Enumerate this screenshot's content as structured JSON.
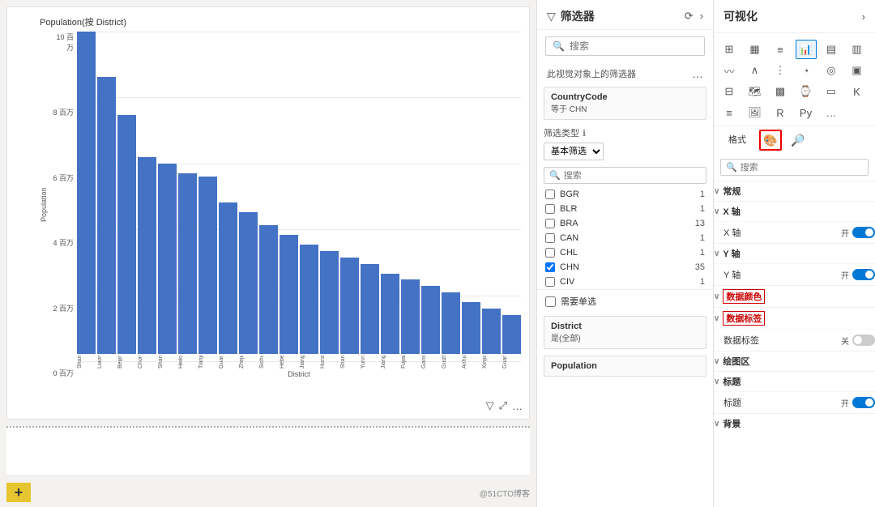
{
  "chart": {
    "title": "Population(按 District)",
    "y_axis_label": "Population",
    "x_axis_title": "District",
    "y_labels": [
      "10 百万",
      "8 百万",
      "6 百万",
      "4 百万",
      "2 百万",
      "0 百万"
    ],
    "bars": [
      {
        "label": "Shanghai",
        "value": 100
      },
      {
        "label": "Liaoning",
        "value": 86
      },
      {
        "label": "Beijing",
        "value": 74
      },
      {
        "label": "Chongqing",
        "value": 61
      },
      {
        "label": "Shandong",
        "value": 59
      },
      {
        "label": "Heilongjiang",
        "value": 56
      },
      {
        "label": "Tianjin",
        "value": 55
      },
      {
        "label": "Guangdong",
        "value": 47
      },
      {
        "label": "Zhejiang",
        "value": 44
      },
      {
        "label": "Sichuan",
        "value": 40
      },
      {
        "label": "Hebei",
        "value": 37
      },
      {
        "label": "Jiangsu",
        "value": 34
      },
      {
        "label": "Hunan",
        "value": 32
      },
      {
        "label": "Shanxi",
        "value": 30
      },
      {
        "label": "Yunnan",
        "value": 28
      },
      {
        "label": "Jiangxi",
        "value": 25
      },
      {
        "label": "Fujian",
        "value": 23
      },
      {
        "label": "Gansu",
        "value": 21
      },
      {
        "label": "Guizhou",
        "value": 19
      },
      {
        "label": "Anhui",
        "value": 16
      },
      {
        "label": "Xinjiang",
        "value": 14
      },
      {
        "label": "Guangxi",
        "value": 12
      }
    ],
    "toolbar_icons": [
      "filter",
      "expand",
      "more"
    ]
  },
  "filter_panel": {
    "title": "筛选器",
    "search_placeholder": "搜索",
    "section_label": "此视觉对象上的筛选器",
    "country_filter": {
      "title": "CountryCode",
      "subtitle": "等于 CHN",
      "type_label": "筛选类型",
      "type_icon": "ℹ",
      "type_select_value": "基本筛选",
      "search_placeholder": "搜索",
      "items": [
        {
          "code": "BGR",
          "count": "1",
          "checked": false
        },
        {
          "code": "BLR",
          "count": "1",
          "checked": false
        },
        {
          "code": "BRA",
          "count": "13",
          "checked": false
        },
        {
          "code": "CAN",
          "count": "1",
          "checked": false
        },
        {
          "code": "CHL",
          "count": "1",
          "checked": false
        },
        {
          "code": "CHN",
          "count": "35",
          "checked": true
        },
        {
          "code": "CIV",
          "count": "1",
          "checked": false
        }
      ],
      "require_single_label": "需要单选"
    },
    "district_filter": {
      "title": "District",
      "subtitle": "是(全部)"
    },
    "population_filter": {
      "title": "Population"
    }
  },
  "vis_panel": {
    "title": "可视化",
    "icons": [
      {
        "name": "table-icon",
        "char": "⊞"
      },
      {
        "name": "bar-chart-icon",
        "char": "📊"
      },
      {
        "name": "stacked-bar-icon",
        "char": "≡"
      },
      {
        "name": "column-chart-icon",
        "char": "📈"
      },
      {
        "name": "stacked-col-icon",
        "char": "▦"
      },
      {
        "name": "100-bar-icon",
        "char": "▤"
      },
      {
        "name": "line-icon",
        "char": "〰"
      },
      {
        "name": "area-icon",
        "char": "∧"
      },
      {
        "name": "scatter-icon",
        "char": "⋮"
      },
      {
        "name": "pie-icon",
        "char": "◔"
      },
      {
        "name": "donut-icon",
        "char": "◎"
      },
      {
        "name": "treemap-icon",
        "char": "▣"
      },
      {
        "name": "matrix-icon",
        "char": "⊟"
      },
      {
        "name": "map-icon",
        "char": "🗺"
      },
      {
        "name": "filled-map-icon",
        "char": "▦"
      },
      {
        "name": "gauge-icon",
        "char": "⌚"
      },
      {
        "name": "card-icon",
        "char": "▭"
      },
      {
        "name": "kpi-icon",
        "char": "K"
      },
      {
        "name": "slicer-icon",
        "char": "≡"
      },
      {
        "name": "image-icon",
        "char": "🖼"
      },
      {
        "name": "r-icon",
        "char": "R"
      },
      {
        "name": "py-icon",
        "char": "Py"
      },
      {
        "name": "more-icon",
        "char": "..."
      }
    ],
    "format_tabs": [
      "格式",
      "分析"
    ],
    "active_format_tab": "格式",
    "format_icons": [
      "paint-bucket",
      "magnify"
    ],
    "search_placeholder": "搜索",
    "sections": [
      {
        "key": "general",
        "label": "常规",
        "expanded": true,
        "properties": []
      },
      {
        "key": "x-axis",
        "label": "X 轴",
        "expanded": true,
        "properties": [
          {
            "label": "X 轴",
            "toggle": "on",
            "toggle_label": "开"
          }
        ]
      },
      {
        "key": "y-axis",
        "label": "Y 轴",
        "expanded": true,
        "properties": [
          {
            "label": "Y 轴",
            "toggle": "on",
            "toggle_label": "开"
          }
        ]
      },
      {
        "key": "data-color",
        "label": "数据颜色",
        "expanded": true,
        "properties": [],
        "highlighted": true
      },
      {
        "key": "data-labels",
        "label": "数据标签",
        "expanded": true,
        "properties": [
          {
            "label": "数据标签",
            "toggle": "off",
            "toggle_label": "关"
          }
        ],
        "highlighted": true
      },
      {
        "key": "plot-area",
        "label": "绘图区",
        "expanded": true,
        "properties": []
      },
      {
        "key": "title",
        "label": "标题",
        "expanded": true,
        "properties": [
          {
            "label": "标题",
            "toggle": "on",
            "toggle_label": "开"
          }
        ]
      },
      {
        "key": "background",
        "label": "背景",
        "expanded": true,
        "properties": []
      }
    ]
  },
  "bottom_bar": {
    "add_button_label": "+",
    "watermark": "@51CTO博客"
  }
}
